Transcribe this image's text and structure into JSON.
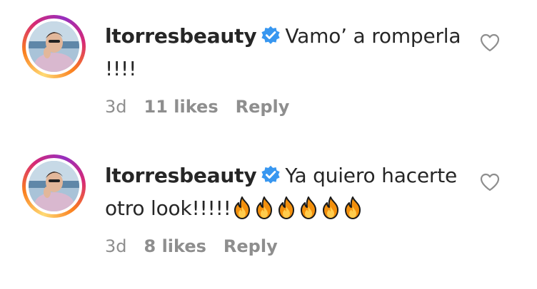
{
  "comments": [
    {
      "username": "ltorresbeauty",
      "text_line1": "Vamo’ a romperla",
      "text_line2": "!!!!",
      "fire_count": 0,
      "time": "3d",
      "likes": "11 likes",
      "reply_label": "Reply"
    },
    {
      "username": "ltorresbeauty",
      "text_line1": "Ya quiero hacerte",
      "text_line2": "otro look!!!!!",
      "fire_count": 6,
      "time": "3d",
      "likes": "8 likes",
      "reply_label": "Reply"
    }
  ],
  "icons": {
    "verified": "verified-badge-icon",
    "like": "heart-outline-icon",
    "emoji": "fire-emoji"
  },
  "colors": {
    "verified_blue": "#3897f0",
    "meta_gray": "#8e8e8e",
    "text": "#262626"
  }
}
